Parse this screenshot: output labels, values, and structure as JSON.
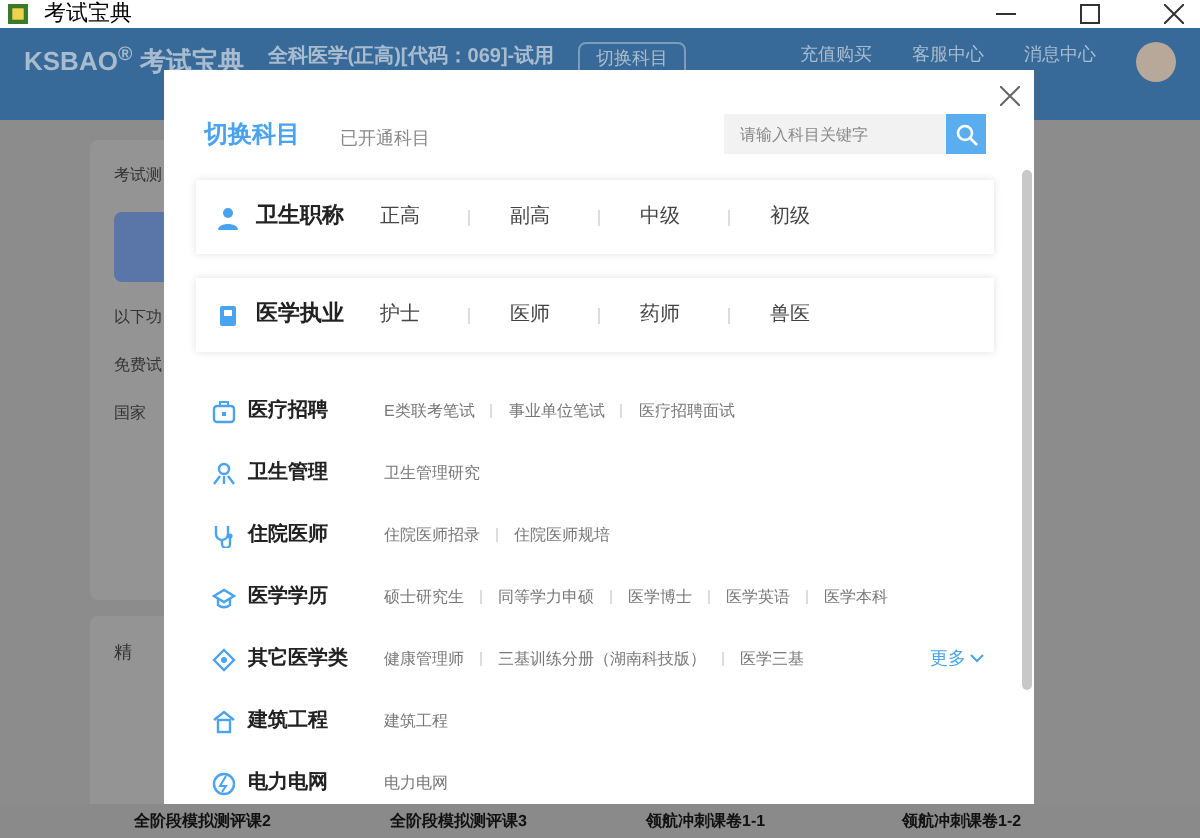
{
  "window": {
    "title": "考试宝典"
  },
  "header": {
    "logo": "KSBAO",
    "logo_mark": "®",
    "app_name": "考试宝典",
    "subject": "全科医学(正高)[代码：069]-试用",
    "switch_button": "切换科目",
    "links": [
      "充值购买",
      "客服中心",
      "消息中心"
    ]
  },
  "background": {
    "texts": [
      "考试测",
      "以下功",
      "免费试",
      "国家",
      "精"
    ],
    "cards": [
      "全阶段模拟测评课2",
      "全阶段模拟测评课3",
      "领航冲刺课卷1-1",
      "领航冲刺课卷1-2"
    ]
  },
  "dialog": {
    "tabs": [
      {
        "label": "切换科目",
        "selected": true
      },
      {
        "label": "已开通科目",
        "selected": false
      }
    ],
    "search": {
      "placeholder": "请输入科目关键字"
    },
    "featured": [
      {
        "title": "卫生职称",
        "options": [
          "正高",
          "副高",
          "中级",
          "初级"
        ]
      },
      {
        "title": "医学执业",
        "options": [
          "护士",
          "医师",
          "药师",
          "兽医"
        ]
      }
    ],
    "categories": [
      {
        "title": "医疗招聘",
        "options": [
          "E类联考笔试",
          "事业单位笔试",
          "医疗招聘面试"
        ]
      },
      {
        "title": "卫生管理",
        "options": [
          "卫生管理研究"
        ]
      },
      {
        "title": "住院医师",
        "options": [
          "住院医师招录",
          "住院医师规培"
        ]
      },
      {
        "title": "医学学历",
        "options": [
          "硕士研究生",
          "同等学力申硕",
          "医学博士",
          "医学英语",
          "医学本科"
        ]
      },
      {
        "title": "其它医学类",
        "options": [
          "健康管理师",
          "三基训练分册（湖南科技版）",
          "医学三基"
        ],
        "more": "更多"
      },
      {
        "title": "建筑工程",
        "options": [
          "建筑工程"
        ]
      },
      {
        "title": "电力电网",
        "options": [
          "电力电网"
        ]
      }
    ]
  }
}
